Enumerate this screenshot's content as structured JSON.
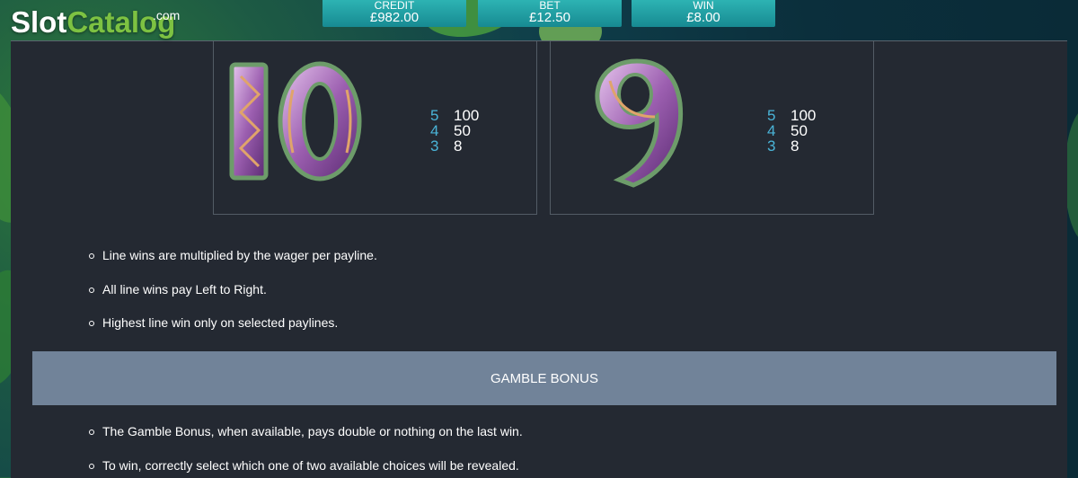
{
  "logo": {
    "slot": "Slot",
    "catalog": "Catalog",
    "com": ".com"
  },
  "stats": {
    "credit": {
      "label": "CREDIT",
      "value": "£982.00"
    },
    "bet": {
      "label": "BET",
      "value": "£12.50"
    },
    "win": {
      "label": "WIN",
      "value": "£8.00"
    }
  },
  "symbols": [
    {
      "icon": "celtic-10-symbol-icon",
      "pays": [
        {
          "count": "5",
          "value": "100"
        },
        {
          "count": "4",
          "value": "50"
        },
        {
          "count": "3",
          "value": "8"
        }
      ]
    },
    {
      "icon": "celtic-9-symbol-icon",
      "pays": [
        {
          "count": "5",
          "value": "100"
        },
        {
          "count": "4",
          "value": "50"
        },
        {
          "count": "3",
          "value": "8"
        }
      ]
    }
  ],
  "rules": [
    "Line wins are multiplied by the wager per payline.",
    "All line wins pay Left to Right.",
    "Highest line win only on selected paylines."
  ],
  "gamble": {
    "title": "GAMBLE BONUS",
    "rules": [
      "The Gamble Bonus, when available, pays double or nothing on the last win.",
      "To win, correctly select which one of two available choices will be revealed."
    ]
  },
  "colors": {
    "panel_bg": "#242932",
    "stat_bar": "#2db3b3",
    "pay_count": "#4ab4d8",
    "gamble_bar": "#718399",
    "logo_green": "#7dc242"
  }
}
